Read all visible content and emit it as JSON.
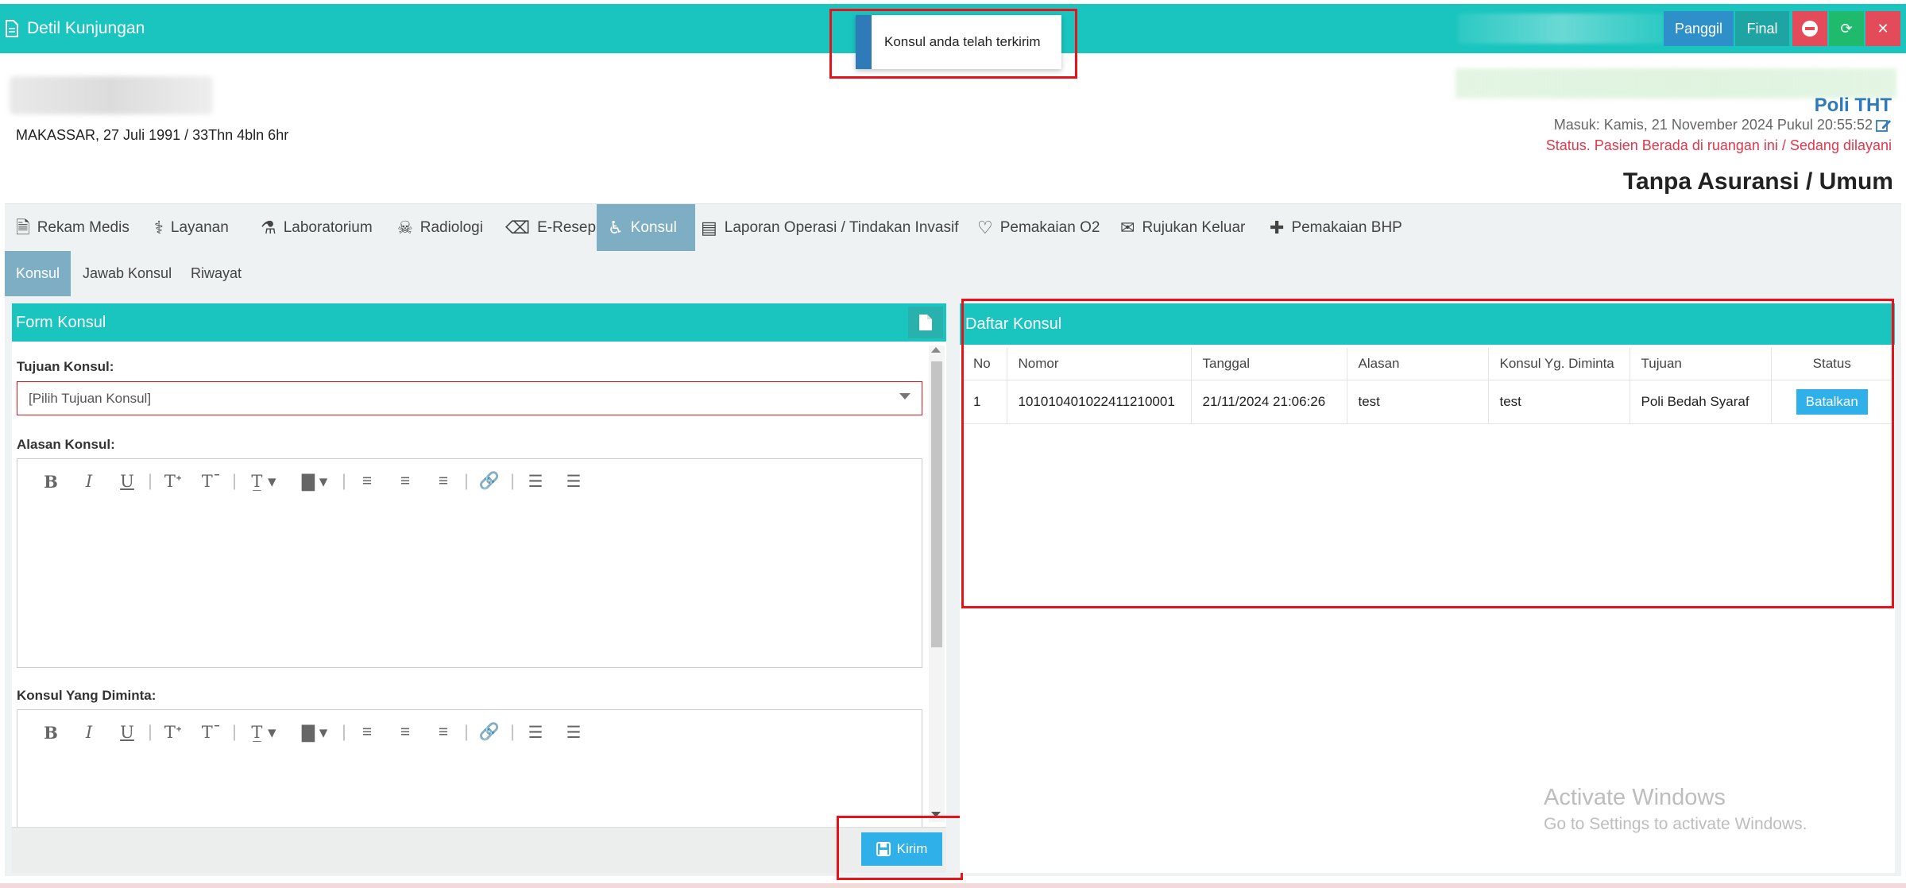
{
  "header": {
    "title": "Detil Kunjungan",
    "buttons": {
      "panggil": "Panggil",
      "final": "Final",
      "minus": "−",
      "refresh": "⟳",
      "close": "✕"
    }
  },
  "toast": {
    "message": "Konsul anda telah terkirim"
  },
  "patient": {
    "info": "MAKASSAR, 27 Juli 1991 / 33Thn 4bln 6hr",
    "poli": "Poli THT",
    "masuk": "Masuk: Kamis, 21 November 2024 Pukul 20:55:52",
    "status": "Status. Pasien Berada di ruangan ini / Sedang dilayani",
    "asuransi": "Tanpa Asuransi / Umum"
  },
  "tabs": [
    {
      "label": "Rekam Medis",
      "icon": "document-icon"
    },
    {
      "label": "Layanan",
      "icon": "doctor-icon"
    },
    {
      "label": "Laboratorium",
      "icon": "flask-icon"
    },
    {
      "label": "Radiologi",
      "icon": "xray-icon"
    },
    {
      "label": "E-Resep",
      "icon": "eraser-icon"
    },
    {
      "label": "Konsul",
      "icon": "wheelchair-icon"
    },
    {
      "label": "Laporan Operasi / Tindakan Invasif",
      "icon": "newspaper-icon"
    },
    {
      "label": "Pemakaian O2",
      "icon": "heart-icon"
    },
    {
      "label": "Rujukan Keluar",
      "icon": "envelope-icon"
    },
    {
      "label": "Pemakaian BHP",
      "icon": "medkit-icon"
    }
  ],
  "subtabs": [
    "Konsul",
    "Jawab Konsul",
    "Riwayat"
  ],
  "form": {
    "title": "Form Konsul",
    "tujuan_label": "Tujuan Konsul:",
    "tujuan_placeholder": "[Pilih Tujuan Konsul]",
    "alasan_label": "Alasan Konsul:",
    "diminta_label": "Konsul Yang Diminta:",
    "submit_label": "Kirim"
  },
  "list": {
    "title": "Daftar Konsul",
    "columns": [
      "No",
      "Nomor",
      "Tanggal",
      "Alasan",
      "Konsul Yg. Diminta",
      "Tujuan",
      "Status"
    ],
    "rows": [
      {
        "no": "1",
        "nomor": "101010401022411210001",
        "tanggal": "21/11/2024 21:06:26",
        "alasan": "test",
        "diminta": "test",
        "tujuan": "Poli Bedah Syaraf",
        "action": "Batalkan"
      }
    ]
  },
  "watermark": {
    "line1": "Activate Windows",
    "line2": "Go to Settings to activate Windows."
  }
}
